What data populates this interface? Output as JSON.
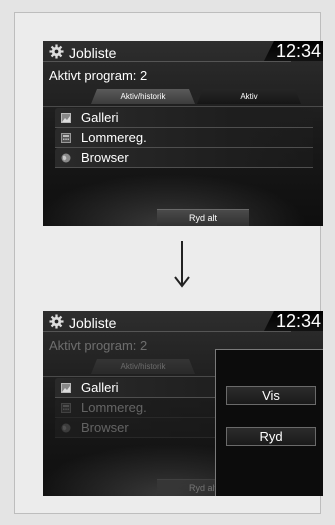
{
  "colors": {
    "screen_bg": "#1a1a1a",
    "page_bg": "#e4e4e4",
    "text": "#ffffff",
    "popup_border": "#7a7a7a"
  },
  "top_screen": {
    "status_bar": {
      "title": "Jobliste",
      "clock": "12:34",
      "settings_icon": "gear-icon"
    },
    "subtitle": "Aktivt program: 2",
    "tabs": [
      {
        "label": "Aktiv/historik",
        "selected": true
      },
      {
        "label": "Aktiv",
        "selected": false
      }
    ],
    "items": [
      {
        "label": "Galleri",
        "icon": "gallery-icon"
      },
      {
        "label": "Lommereg.",
        "icon": "calculator-icon"
      },
      {
        "label": "Browser",
        "icon": "globe-icon"
      }
    ],
    "clear_all_label": "Ryd alt"
  },
  "arrow_icon": "arrow-down-icon",
  "bottom_screen": {
    "status_bar": {
      "title": "Jobliste",
      "clock": "12:34",
      "settings_icon": "gear-icon"
    },
    "subtitle": "Aktivt program: 2",
    "tabs": [
      {
        "label": "Aktiv/historik",
        "selected": true
      }
    ],
    "items": [
      {
        "label": "Galleri",
        "icon": "gallery-icon",
        "highlighted": true
      },
      {
        "label": "Lommereg.",
        "icon": "calculator-icon",
        "highlighted": false
      },
      {
        "label": "Browser",
        "icon": "globe-icon",
        "highlighted": false
      }
    ],
    "clear_all_label": "Ryd alt",
    "popup": {
      "view_label": "Vis",
      "delete_label": "Ryd"
    }
  }
}
